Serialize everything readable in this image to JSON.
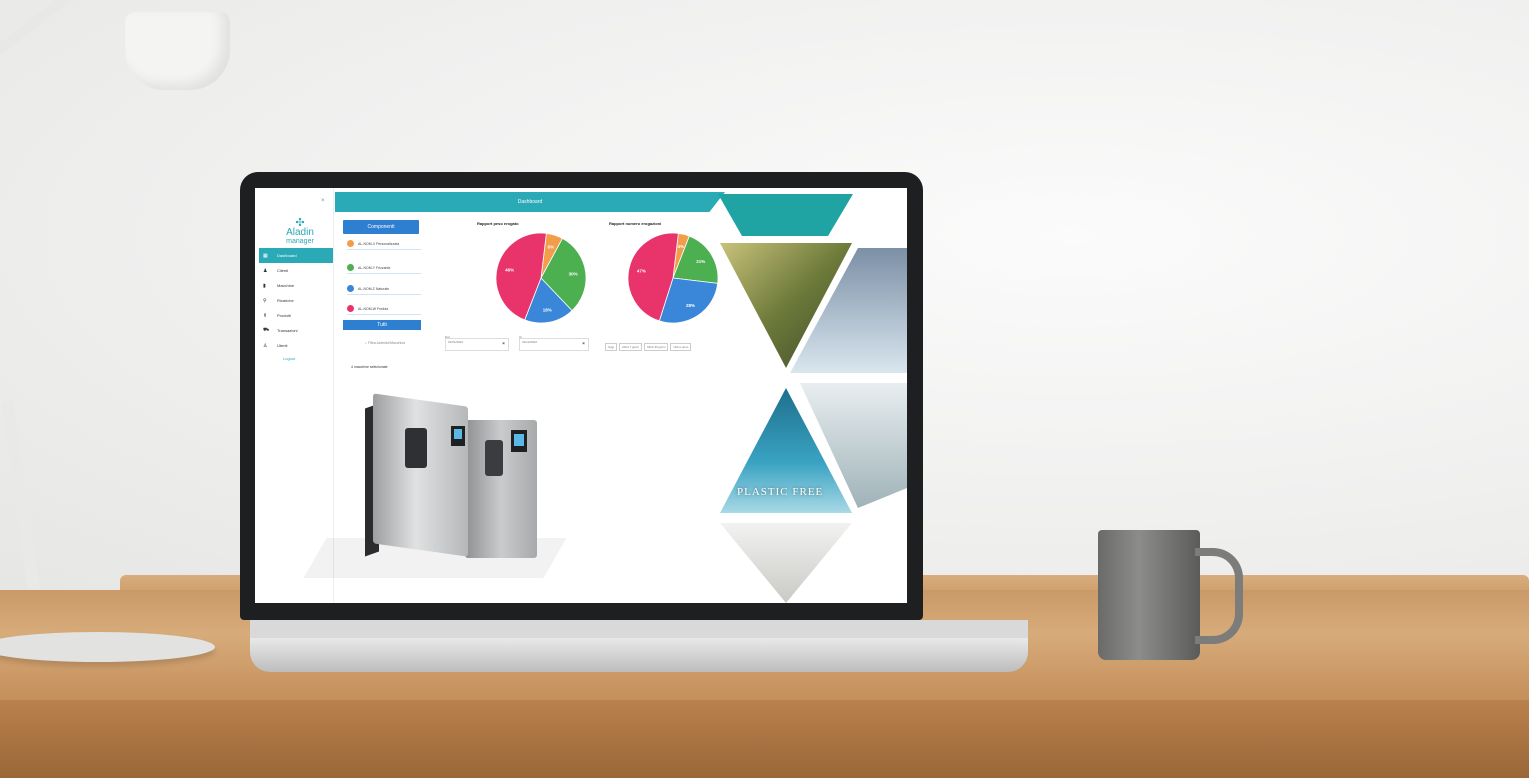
{
  "app": {
    "brand_top": "Aladin",
    "brand_bottom": "manager",
    "collapse": "×",
    "header_title": "Dashboard"
  },
  "sidebar": {
    "items": [
      {
        "label": "Dashboard",
        "icon": "grid-icon",
        "active": true
      },
      {
        "label": "Clienti",
        "icon": "people-icon"
      },
      {
        "label": "Macchine",
        "icon": "machine-icon"
      },
      {
        "label": "Ricariche",
        "icon": "refill-icon"
      },
      {
        "label": "Prodotti",
        "icon": "bottle-icon"
      },
      {
        "label": "Transazioni",
        "icon": "cart-icon"
      },
      {
        "label": "Utenti",
        "icon": "user-icon"
      }
    ],
    "footer_link": "Logout"
  },
  "components": {
    "button": "Componenti",
    "legend": [
      {
        "label": "AL-NOM-X Personalizzata",
        "color": "#f39c4a"
      },
      {
        "label": "AL-NOM-Y Frizzante",
        "color": "#4caf50"
      },
      {
        "label": "AL-NOM-Z Naturale",
        "color": "#3a86d8"
      },
      {
        "label": "AL-NOM-W Fredda",
        "color": "#e8336b"
      }
    ],
    "all_button": "Tutti"
  },
  "filters": {
    "search_placeholder": "Filtra Aziende/Macchina",
    "from_label": "Dal",
    "from_value": "01/01/2022",
    "to_label": "Al",
    "to_value": "31/12/2022",
    "ranges": [
      "Oggi",
      "Ultimi 7 giorni",
      "Ultimi 30 giorni",
      "Ultimo anno"
    ],
    "count_text": "4 macchine selezionate"
  },
  "collage": {
    "caption": "PLASTIC FREE"
  },
  "chart_data": [
    {
      "type": "pie",
      "title": "Rapport peso erogato",
      "categories": [
        "AL-NOM-X",
        "AL-NOM-Y",
        "AL-NOM-Z",
        "AL-NOM-W"
      ],
      "values": [
        6.0,
        30.0,
        18.0,
        46.0
      ],
      "labels": [
        "6%",
        "30%",
        "18%",
        "46%"
      ],
      "colors": [
        "#f39c4a",
        "#4caf50",
        "#3a86d8",
        "#e8336b"
      ]
    },
    {
      "type": "pie",
      "title": "Rapport numero erogazioni",
      "categories": [
        "AL-NOM-X",
        "AL-NOM-Y",
        "AL-NOM-Z",
        "AL-NOM-W"
      ],
      "values": [
        4.0,
        21.0,
        28.0,
        47.0
      ],
      "labels": [
        "4%",
        "21%",
        "28%",
        "47%"
      ],
      "colors": [
        "#f39c4a",
        "#4caf50",
        "#3a86d8",
        "#e8336b"
      ]
    }
  ]
}
